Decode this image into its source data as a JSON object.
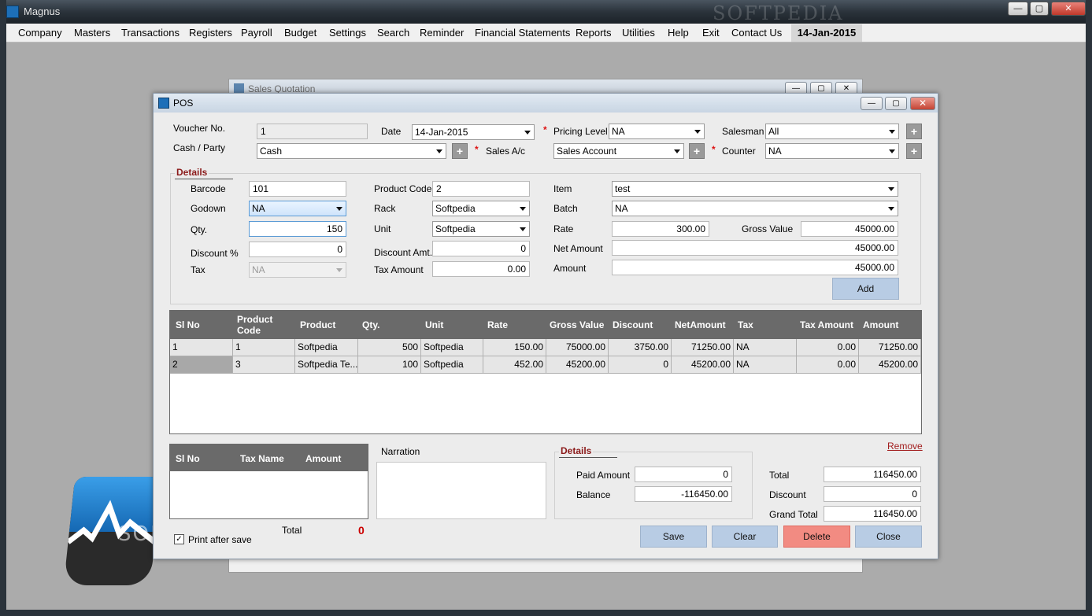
{
  "app": {
    "title": "Magnus",
    "watermark": "SOFTPEDIA",
    "logo_text": "SOFTPEDIA",
    "controls": {
      "minimize": "—",
      "restore": "▢",
      "close": "✕"
    }
  },
  "menu": {
    "items": [
      "Company",
      "Masters",
      "Transactions",
      "Registers",
      "Payroll",
      "Budget",
      "Settings",
      "Search",
      "Reminder",
      "Financial Statements",
      "Reports",
      "Utilities",
      "Help",
      "Exit",
      "Contact Us"
    ],
    "date": "14-Jan-2015"
  },
  "bg_window": {
    "title": "Sales Quotation"
  },
  "pos": {
    "title": "POS",
    "header": {
      "voucher_label": "Voucher No.",
      "voucher_value": "1",
      "date_label": "Date",
      "date_value": "14-Jan-2015",
      "pricing_label": "Pricing Level",
      "pricing_value": "NA",
      "salesman_label": "Salesman",
      "salesman_value": "All",
      "cash_label": "Cash / Party",
      "cash_value": "Cash",
      "salesac_label": "Sales A/c",
      "salesac_value": "Sales Account",
      "counter_label": "Counter",
      "counter_value": "NA",
      "required_mark": "*",
      "plus": "+"
    },
    "details": {
      "title": "Details",
      "barcode_label": "Barcode",
      "barcode_value": "101",
      "product_code_label": "Product Code",
      "product_code_value": "2",
      "item_label": "Item",
      "item_value": "test",
      "godown_label": "Godown",
      "godown_value": "NA",
      "rack_label": "Rack",
      "rack_value": "Softpedia",
      "batch_label": "Batch",
      "batch_value": "NA",
      "qty_label": "Qty.",
      "qty_value": "150",
      "unit_label": "Unit",
      "unit_value": "Softpedia",
      "rate_label": "Rate",
      "rate_value": "300.00",
      "gross_label": "Gross Value",
      "gross_value": "45000.00",
      "disc_pct_label": "Discount %",
      "disc_pct_value": "0",
      "disc_amt_label": "Discount Amt.",
      "disc_amt_value": "0",
      "net_label": "Net Amount",
      "net_value": "45000.00",
      "tax_label": "Tax",
      "tax_value": "NA",
      "tax_amt_label": "Tax Amount",
      "tax_amt_value": "0.00",
      "amount_label": "Amount",
      "amount_value": "45000.00",
      "add_label": "Add"
    },
    "grid": {
      "columns": [
        "Sl No",
        "Product Code",
        "Product",
        "Qty.",
        "Unit",
        "Rate",
        "Gross Value",
        "Discount",
        "NetAmount",
        "Tax",
        "Tax Amount",
        "Amount"
      ],
      "rows": [
        [
          "1",
          "1",
          "Softpedia",
          "500",
          "Softpedia",
          "150.00",
          "75000.00",
          "3750.00",
          "71250.00",
          "NA",
          "0.00",
          "71250.00"
        ],
        [
          "2",
          "3",
          "Softpedia Te...",
          "100",
          "Softpedia",
          "452.00",
          "45200.00",
          "0",
          "45200.00",
          "NA",
          "0.00",
          "45200.00"
        ]
      ]
    },
    "tax_grid": {
      "columns": [
        "Sl No",
        "Tax Name",
        "Amount"
      ],
      "total_label": "Total",
      "total_value": "0"
    },
    "narration_label": "Narration",
    "remove_label": "Remove",
    "print_after_save": "Print after save",
    "print_checked": "✓",
    "payment": {
      "title": "Details",
      "paid_label": "Paid Amount",
      "paid_value": "0",
      "balance_label": "Balance",
      "balance_value": "-116450.00"
    },
    "totals": {
      "total_label": "Total",
      "total_value": "116450.00",
      "discount_label": "Discount",
      "discount_value": "0",
      "grand_label": "Grand Total",
      "grand_value": "116450.00"
    },
    "buttons": {
      "save": "Save",
      "clear": "Clear",
      "delete": "Delete",
      "close": "Close"
    }
  }
}
